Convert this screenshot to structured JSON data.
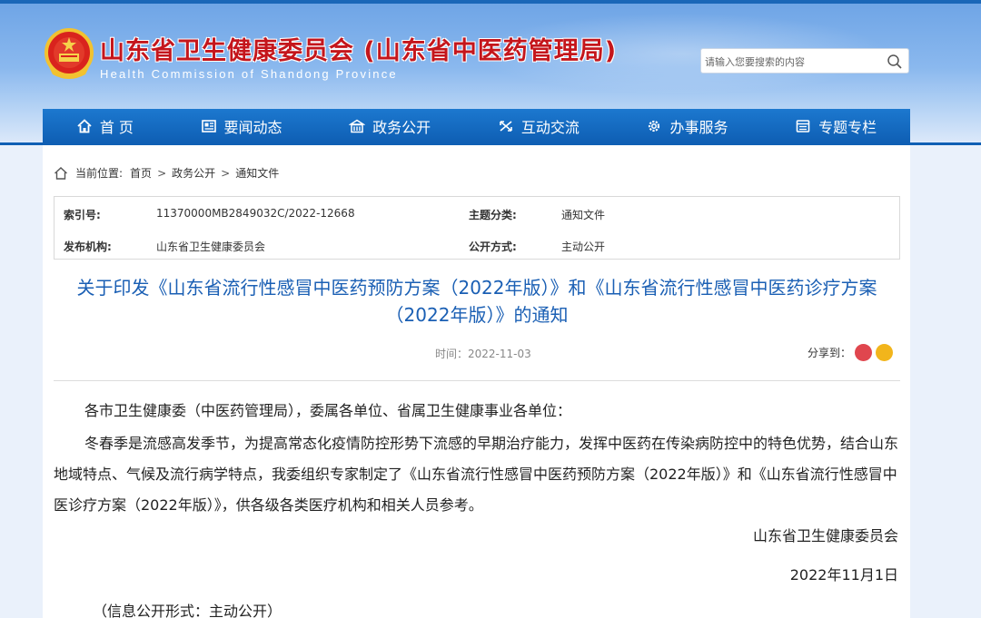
{
  "header": {
    "title": "山东省卫生健康委员会 (山东省中医药管理局)",
    "subtitle": "Health Commission of Shandong Province",
    "search_placeholder": "请输入您要搜索的内容"
  },
  "nav": [
    {
      "label": "首 页",
      "icon": "home-icon"
    },
    {
      "label": "要闻动态",
      "icon": "news-icon"
    },
    {
      "label": "政务公开",
      "icon": "building-icon"
    },
    {
      "label": "互动交流",
      "icon": "exchange-icon"
    },
    {
      "label": "办事服务",
      "icon": "gear-icon"
    },
    {
      "label": "专题专栏",
      "icon": "column-icon"
    }
  ],
  "breadcrumb": {
    "prefix": "当前位置:",
    "items": [
      "首页",
      "政务公开",
      "通知文件"
    ],
    "sep": ">"
  },
  "meta": {
    "index_label": "索引号:",
    "index_value": "11370000MB2849032C/2022-12668",
    "topic_label": "主题分类:",
    "topic_value": "通知文件",
    "issuer_label": "发布机构:",
    "issuer_value": "山东省卫生健康委员会",
    "mode_label": "公开方式:",
    "mode_value": "主动公开"
  },
  "article": {
    "title": "关于印发《山东省流行性感冒中医药预防方案（2022年版）》和《山东省流行性感冒中医药诊疗方案（2022年版）》的通知",
    "date": "时间：2022-11-03",
    "share_label": "分享到：",
    "greeting": "各市卫生健康委（中医药管理局），委属各单位、省属卫生健康事业各单位：",
    "paragraph": "冬春季是流感高发季节，为提高常态化疫情防控形势下流感的早期治疗能力，发挥中医药在传染病防控中的特色优势，结合山东地域特点、气候及流行病学特点，我委组织专家制定了《山东省流行性感冒中医药预防方案（2022年版）》和《山东省流行性感冒中医诊疗方案（2022年版）》，供各级各类医疗机构和相关人员参考。",
    "signature": "山东省卫生健康委员会",
    "sign_date": "2022年11月1日",
    "footnote": "（信息公开形式：主动公开）"
  },
  "colors": {
    "brand_blue": "#0f5fb4",
    "title_red": "#c4161c",
    "title_blue": "#1a5fb4"
  }
}
